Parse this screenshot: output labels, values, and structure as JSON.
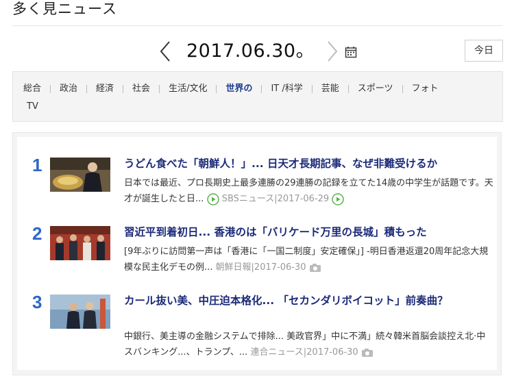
{
  "page": {
    "title": "多く見ニュース"
  },
  "date_nav": {
    "date": "2017.06.30。",
    "today_label": "今日"
  },
  "categories": {
    "row1": [
      "総合",
      "政治",
      "経済",
      "社会",
      "生活/文化",
      "世界の",
      "IT /科学",
      "芸能",
      "スポーツ",
      "フォト"
    ],
    "row2": "TV",
    "active": "世界の"
  },
  "news": [
    {
      "rank": "1",
      "headline": "うどん食べた「朝鮮人！」... 日天才長期記事、なぜ非難受けるか",
      "summary": "日本では最近、プロ長期史上最多連勝の29連勝の記録を立てた14歳の中学生が話題です。天才が誕生したと日...",
      "source": "SBSニュース|2017-06-29",
      "icon": "play-icon"
    },
    {
      "rank": "2",
      "headline": "習近平到着初日... 香港のは「バリケード万里の長城」積もった",
      "summary": "[9年ぶりに訪問第一声は「香港に「一国二制度」安定確保」] -明日香港返還20周年記念大規模な民主化デモの例...",
      "source": "朝鮮日報|2017-06-30",
      "icon": "camera-icon"
    },
    {
      "rank": "3",
      "headline": "カール抜い美、中圧迫本格化... 「セカンダリボイコット」前奏曲？",
      "summary": "中銀行、美主導の金融システムで排除... 美政官界」中に不満」続々韓米首脳会談控え北·中スバンキング...、トランプ、...",
      "source": "連合ニュース|2017-06-30",
      "icon": "camera-icon"
    }
  ]
}
